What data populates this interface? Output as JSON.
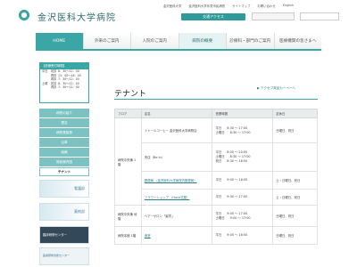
{
  "header": {
    "logo_text": "金沢医科大学病院",
    "top_links": [
      "金沢医科大学",
      "金沢医科大学氷見市民病院",
      "サイトマップ",
      "お問い合わせ",
      "English"
    ],
    "access_button": "交通アクセス"
  },
  "gnav": {
    "items": [
      "HOME",
      "外来のご案内",
      "入院のご案内",
      "病院の概要",
      "診療科・部門のご案内",
      "医療機関の皆さまへ"
    ],
    "active": "病院の概要"
  },
  "sidebar": {
    "hours_title": "【診療受付時間】",
    "hours_rows": [
      {
        "day": "平日",
        "kind": "初診",
        "time": "8：30～12：00"
      },
      {
        "day": "",
        "kind": "再診",
        "time": "13：00～16：00"
      },
      {
        "day": "",
        "kind": "再診",
        "time": "7：30～12：00"
      },
      {
        "day": "土曜",
        "kind": "初診",
        "time": "8：30～12：00"
      },
      {
        "day": "",
        "kind": "再診",
        "time": "7：30～12：00"
      }
    ],
    "menu": [
      "病院の紹介",
      "理念",
      "病院長挨拶",
      "沿革",
      "組織",
      "施設案内図",
      "テナント"
    ],
    "current": "テナント",
    "banners": [
      "看護部",
      "薬剤部",
      "臨床研修センター",
      "医療研修支援センター"
    ]
  },
  "main": {
    "title": "テナント",
    "store_link": "アクセプ商品カーペーへ",
    "table": {
      "headers": [
        "フロア",
        "店名",
        "営業時間",
        "定休日"
      ],
      "rows": [
        {
          "floor": "",
          "name": "ドトールコーヒー 金沢医科大学病院店",
          "hours": [
            [
              "平日",
              "6:30 ～ 17:00"
            ],
            [
              "土曜日",
              "8:30 ～ 17:00"
            ]
          ],
          "closed": "日曜日、祝日"
        },
        {
          "floor": "病院中央棟 1階",
          "name": "売店（Be In）",
          "hours": [
            [
              "平日",
              "8:00 ～ 20:00"
            ],
            [
              "土曜日",
              "8:30 ～ 17:00"
            ],
            [
              "祝日",
              "8:30 ～ 16:00"
            ]
          ],
          "closed": ""
        },
        {
          "floor": "",
          "name": "郵便局 〈金沢医科大学病院内郵便局〉",
          "hours": [
            [
              "平日",
              "9:00 ～ 16:00"
            ]
          ],
          "closed": "土・日曜日、祝日"
        },
        {
          "floor": "",
          "name": "フラワーショップ 〈Hana花屋〉",
          "hours": [
            [
              "平日",
              "9:30 ～ 17:00"
            ]
          ],
          "closed": "土・日曜日、祝日"
        },
        {
          "floor": "病院中央棟 地階",
          "name": "ヘアーサロン「髪衣」",
          "hours": [
            [
              "平日",
              "9:00 ～ 17:00"
            ],
            [
              "土曜日",
              "9:00 ～ 17:00"
            ]
          ],
          "closed": "日曜日、祝日"
        },
        {
          "floor": "病院本館 1階",
          "name": "食堂",
          "hours": [
            [
              "平日",
              "9:00 ～ 16:00"
            ]
          ],
          "closed": "日曜日、祝日"
        }
      ]
    }
  },
  "colors": {
    "accent": "#3aa6a6",
    "nav_home": "#3aa6a6"
  }
}
